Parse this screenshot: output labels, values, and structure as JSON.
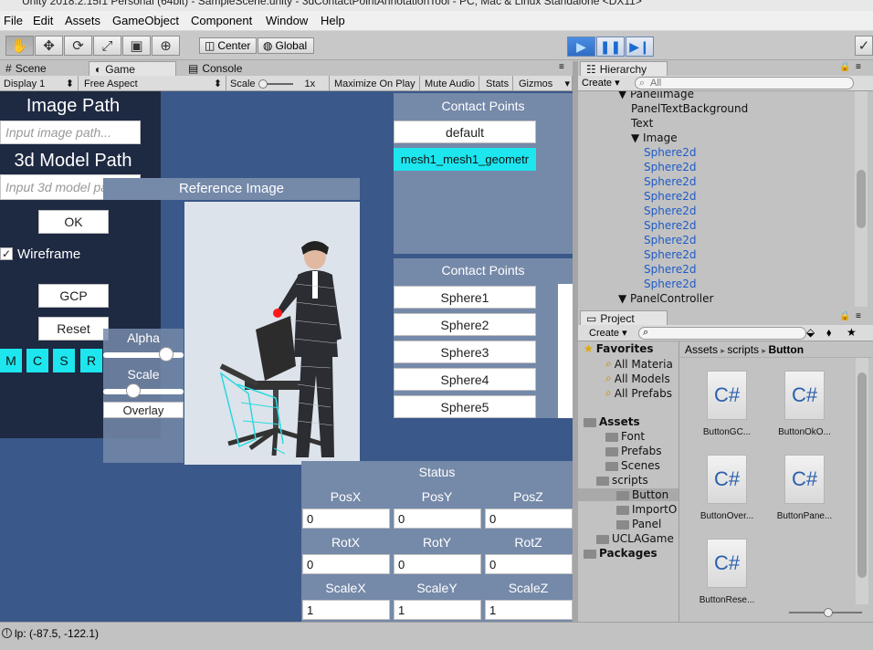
{
  "window": {
    "title": "Unity 2018.2.15f1 Personal (64bit) - SampleScene.unity - 3dContactPointAnnotationTool - PC, Mac & Linux Standalone <DX11>"
  },
  "menu": [
    "File",
    "Edit",
    "Assets",
    "GameObject",
    "Component",
    "Window",
    "Help"
  ],
  "toolbar": {
    "pivot": "Center",
    "space": "Global"
  },
  "tabs": {
    "scene": "Scene",
    "game": "Game",
    "console": "Console",
    "hierarchy": "Hierarchy",
    "project": "Project"
  },
  "gamebar": {
    "display": "Display 1",
    "aspect": "Free Aspect",
    "scale_label": "Scale",
    "scale_value": "1x",
    "maximize": "Maximize On Play",
    "mute": "Mute Audio",
    "stats": "Stats",
    "gizmos": "Gizmos"
  },
  "game": {
    "image_path_label": "Image Path",
    "image_path_placeholder": "Input image path...",
    "model_path_label": "3d Model Path",
    "model_path_placeholder": "Input 3d model path...",
    "ok": "OK",
    "wireframe": "Wireframe",
    "gcp": "GCP",
    "reset": "Reset",
    "mcsr": [
      "M",
      "C",
      "S",
      "R"
    ],
    "alpha": "Alpha",
    "scale": "Scale",
    "alpha_level": 0.85,
    "scale_level": 0.35,
    "overlay": "Overlay",
    "reference_image": "Reference Image",
    "contact_points_title_1": "Contact Points",
    "contact_points_list_1": [
      "default",
      "mesh1_mesh1_geometr"
    ],
    "contact_points_title_2": "Contact Points",
    "contact_points_list_2": [
      "Sphere1",
      "Sphere2",
      "Sphere3",
      "Sphere4",
      "Sphere5"
    ],
    "status": {
      "title": "Status",
      "rows": [
        {
          "labels": [
            "PosX",
            "PosY",
            "PosZ"
          ],
          "values": [
            "0",
            "0",
            "0"
          ]
        },
        {
          "labels": [
            "RotX",
            "RotY",
            "RotZ"
          ],
          "values": [
            "0",
            "0",
            "0"
          ]
        },
        {
          "labels": [
            "ScaleX",
            "ScaleY",
            "ScaleZ"
          ],
          "values": [
            "1",
            "1",
            "1"
          ]
        }
      ]
    }
  },
  "hierarchy": {
    "create": "Create",
    "search": "All",
    "items": [
      {
        "text": "▼ PanelImage",
        "indent": 0,
        "blue": false
      },
      {
        "text": "PanelTextBackground",
        "indent": 1,
        "blue": false
      },
      {
        "text": "Text",
        "indent": 1,
        "blue": false
      },
      {
        "text": "▼ Image",
        "indent": 1,
        "blue": false
      },
      {
        "text": "Sphere2d",
        "indent": 2,
        "blue": true
      },
      {
        "text": "Sphere2d",
        "indent": 2,
        "blue": true
      },
      {
        "text": "Sphere2d",
        "indent": 2,
        "blue": true
      },
      {
        "text": "Sphere2d",
        "indent": 2,
        "blue": true
      },
      {
        "text": "Sphere2d",
        "indent": 2,
        "blue": true
      },
      {
        "text": "Sphere2d",
        "indent": 2,
        "blue": true
      },
      {
        "text": "Sphere2d",
        "indent": 2,
        "blue": true
      },
      {
        "text": "Sphere2d",
        "indent": 2,
        "blue": true
      },
      {
        "text": "Sphere2d",
        "indent": 2,
        "blue": true
      },
      {
        "text": "Sphere2d",
        "indent": 2,
        "blue": true
      },
      {
        "text": "▼ PanelController",
        "indent": 0,
        "blue": false
      }
    ]
  },
  "project": {
    "create": "Create",
    "tree": [
      {
        "text": "Favorites",
        "bold": true,
        "star": true
      },
      {
        "text": "All Materia",
        "fav": true
      },
      {
        "text": "All Models",
        "fav": true
      },
      {
        "text": "All Prefabs",
        "fav": true
      },
      {
        "text": "Assets",
        "bold": true,
        "folder": true
      },
      {
        "text": "Font",
        "folder": true
      },
      {
        "text": "Prefabs",
        "folder": true
      },
      {
        "text": "Scenes",
        "folder": true
      },
      {
        "text": "scripts",
        "folder": true
      },
      {
        "text": "Button",
        "folder": true,
        "selected": true
      },
      {
        "text": "ImportO",
        "folder": true
      },
      {
        "text": "Panel",
        "folder": true
      },
      {
        "text": "UCLAGame",
        "folder": true
      },
      {
        "text": "Packages",
        "bold": true,
        "folder": true
      }
    ],
    "breadcrumb": [
      "Assets",
      "scripts",
      "Button"
    ],
    "files": [
      {
        "icon": "C#",
        "name": "ButtonGC..."
      },
      {
        "icon": "C#",
        "name": "ButtonOkO..."
      },
      {
        "icon": "C#",
        "name": "ButtonOver..."
      },
      {
        "icon": "C#",
        "name": "ButtonPane..."
      },
      {
        "icon": "C#",
        "name": "ButtonRese..."
      }
    ]
  },
  "statusbar": {
    "text": "lp: (-87.5, -122.1)"
  }
}
